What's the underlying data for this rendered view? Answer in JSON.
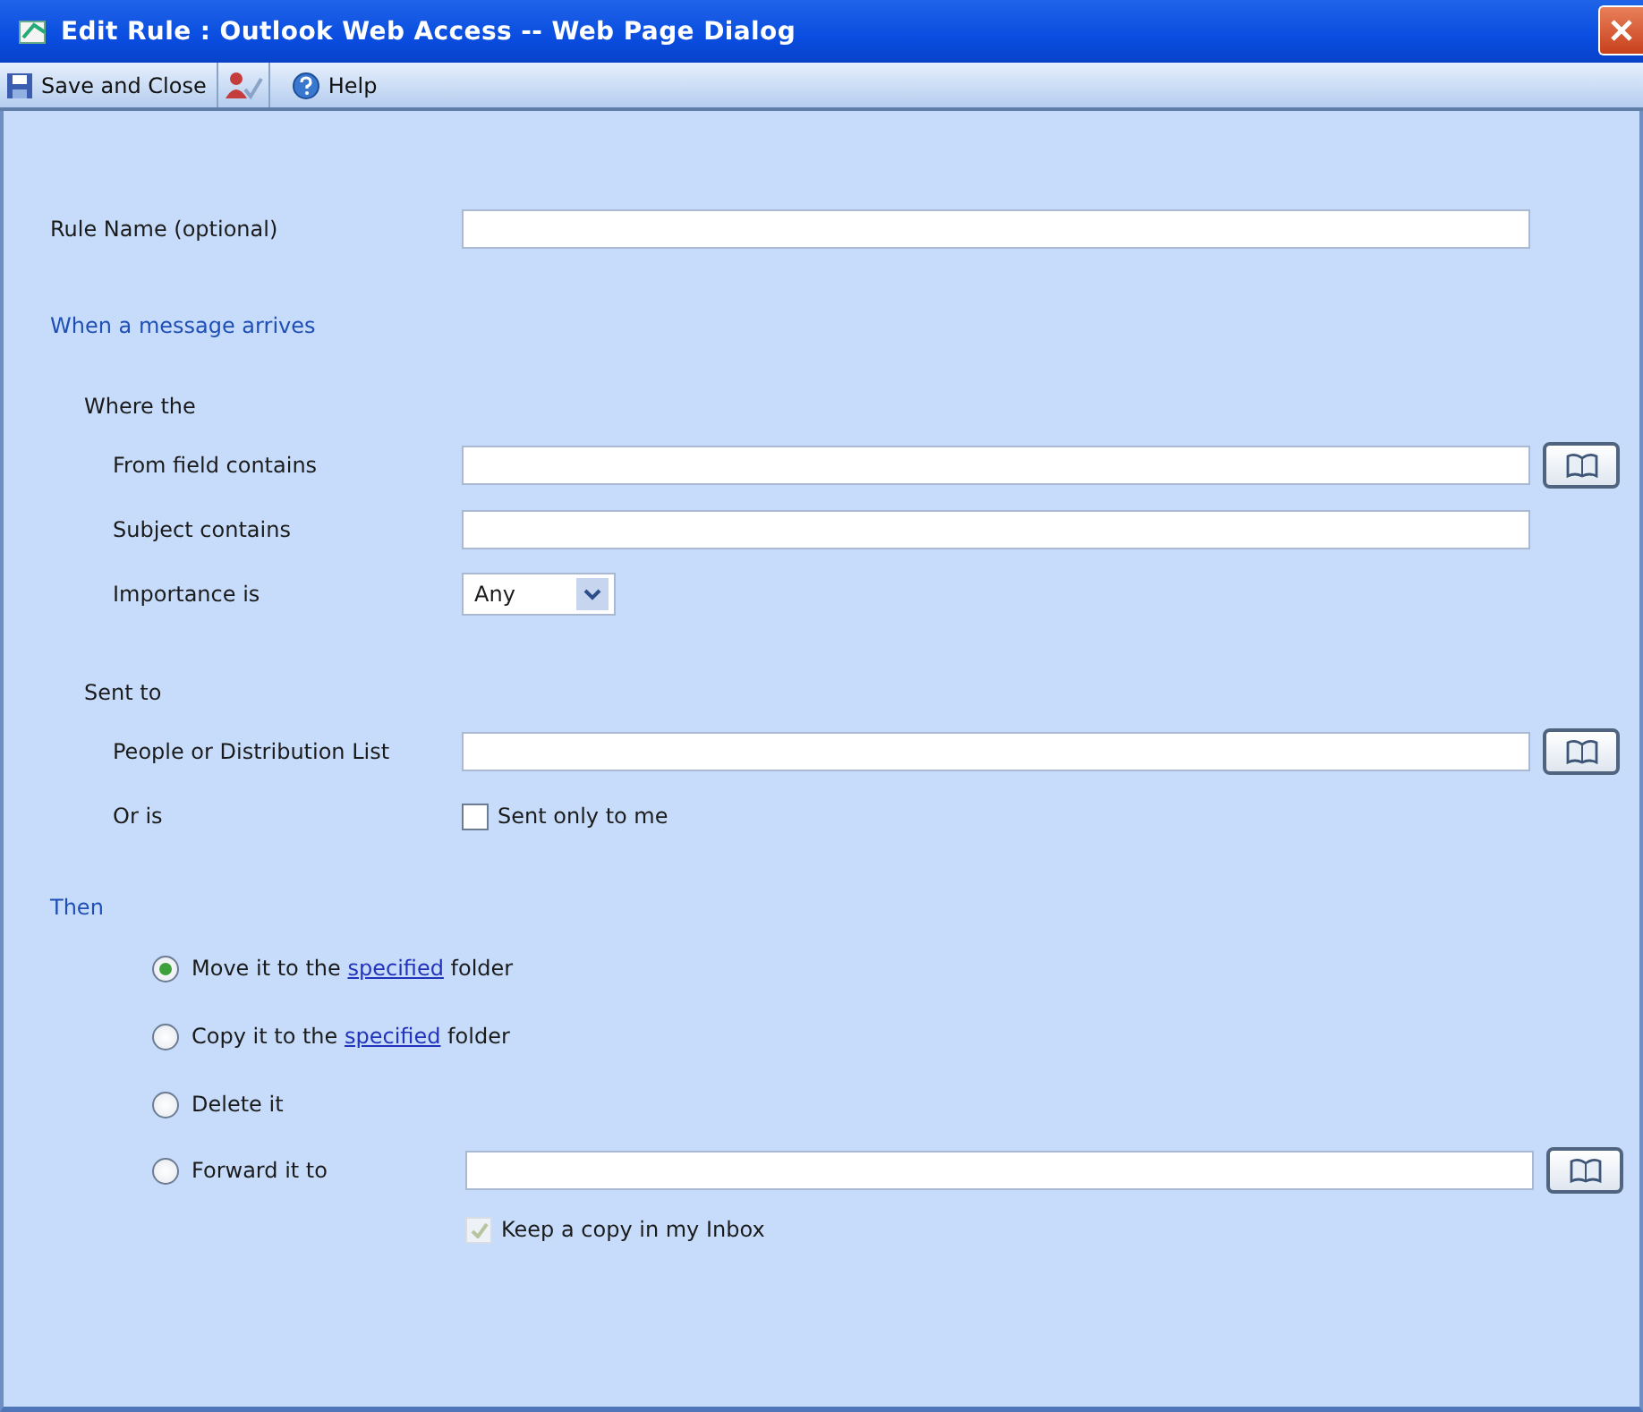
{
  "window": {
    "title": "Edit Rule : Outlook Web Access -- Web Page Dialog"
  },
  "toolbar": [
    {
      "kind": "save",
      "label": "Save and Close"
    },
    {
      "kind": "check-names"
    },
    {
      "kind": "help",
      "label": "Help"
    }
  ],
  "rows": [
    {
      "kind": "field",
      "label": "Rule Name  (optional)",
      "address_book": false,
      "indent": false
    },
    {
      "kind": "heading",
      "label": "When a message arrives"
    },
    {
      "kind": "subheading",
      "label": "Where the"
    },
    {
      "kind": "field",
      "label": "From field contains",
      "address_book": true,
      "indent": true
    },
    {
      "kind": "field",
      "label": "Subject contains",
      "address_book": false,
      "indent": true
    },
    {
      "kind": "select",
      "label": "Importance is",
      "value": "Any"
    },
    {
      "kind": "subheading",
      "label": "Sent to"
    },
    {
      "kind": "field",
      "label": "People or Distribution List",
      "address_book": true,
      "indent": true
    },
    {
      "kind": "checkbox",
      "label": "Or is",
      "option": "Sent only to me",
      "checked": false,
      "disabled": false
    },
    {
      "kind": "heading",
      "label": "Then"
    },
    {
      "kind": "radio",
      "before": "Move it to the ",
      "link": "specified",
      "after": " folder",
      "selected": true
    },
    {
      "kind": "radio",
      "before": "Copy it to the ",
      "link": "specified",
      "after": " folder",
      "selected": false
    },
    {
      "kind": "radio",
      "before": "Delete it",
      "selected": false
    },
    {
      "kind": "radio",
      "before": "Forward it to",
      "selected": false,
      "field": true,
      "address_book": true
    },
    {
      "kind": "checkbox",
      "option": "Keep a copy in my Inbox",
      "checked": true,
      "disabled": true
    }
  ]
}
